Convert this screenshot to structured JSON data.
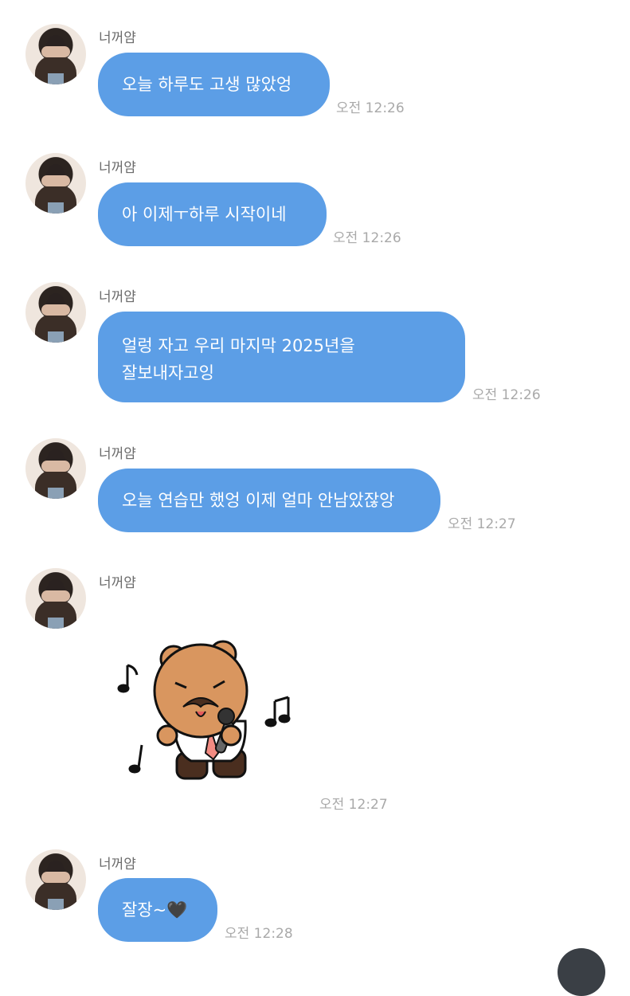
{
  "messages": [
    {
      "sender": "너꺼얌",
      "text": "오늘 하루도 고생 많았엉",
      "time": "오전 12:26"
    },
    {
      "sender": "너꺼얌",
      "text": "아 이제ㅜ하루 시작이네",
      "time": "오전 12:26"
    },
    {
      "sender": "너꺼얌",
      "lines": [
        "얼렁 자고 우리 마지막 2025년을",
        "잘보내자고잉"
      ],
      "time": "오전 12:26"
    },
    {
      "sender": "너꺼얌",
      "text": "오늘 연습만 했엉 이제 얼마 안남았잖앙",
      "time": "오전 12:27"
    },
    {
      "sender": "너꺼얌",
      "sticker": "bear-singing-sticker",
      "time": "오전 12:27"
    },
    {
      "sender": "너꺼얌",
      "text": "잘장~🖤",
      "time": "오전 12:28"
    }
  ],
  "icons": {
    "avatar": "profile-photo",
    "sticker": "mustache-bear-with-microphone"
  },
  "colors": {
    "bubble": "#5c9ee6",
    "bubble_text": "#ffffff",
    "time": "#a9a9a9",
    "sender": "#6b6b6b"
  }
}
